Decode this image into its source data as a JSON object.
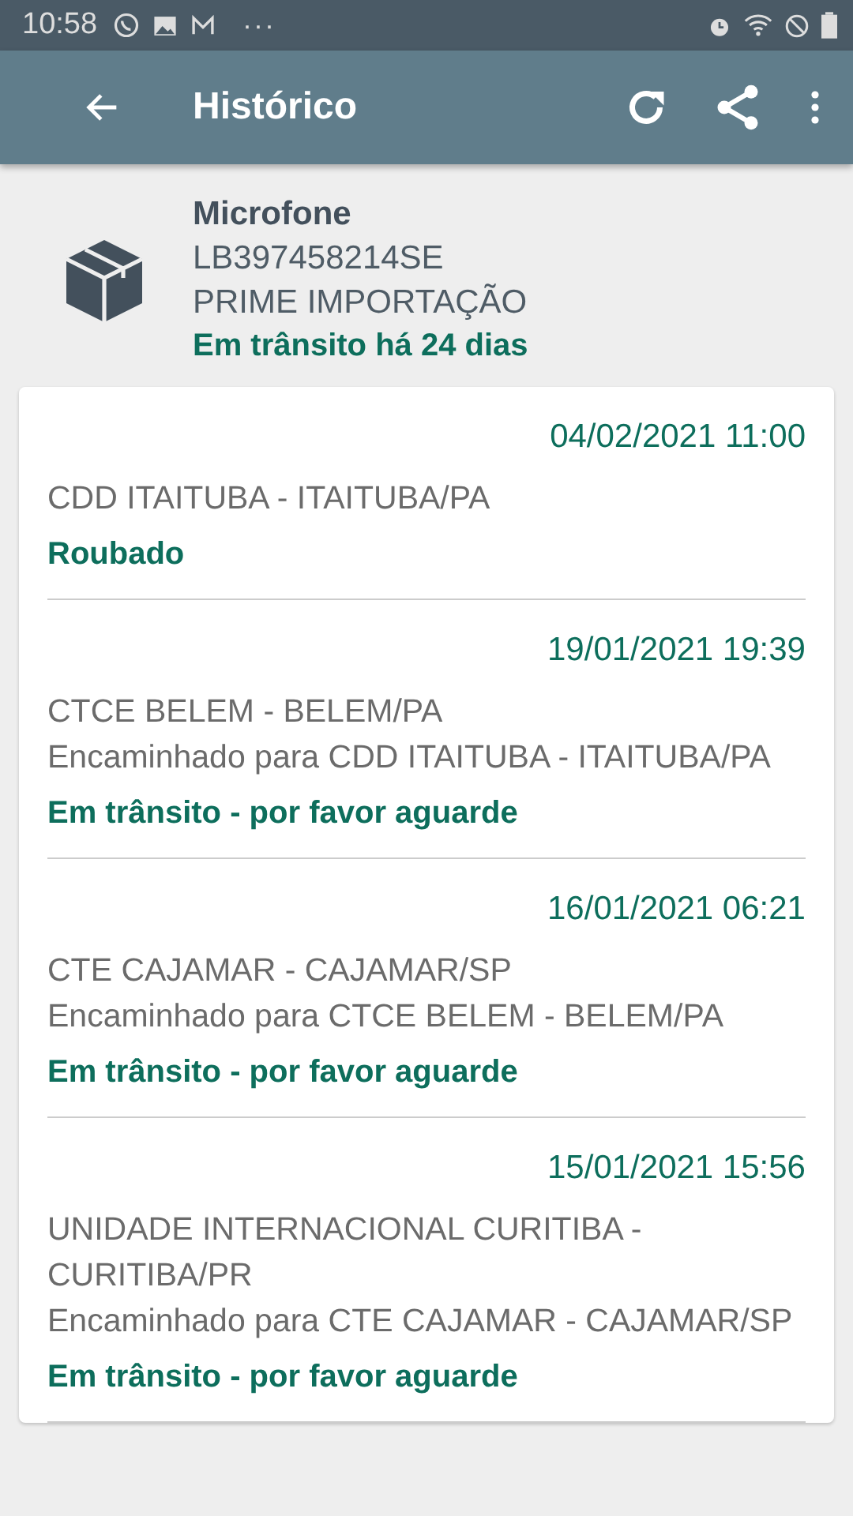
{
  "status_bar": {
    "time": "10:58",
    "more": "···"
  },
  "toolbar": {
    "title": "Histórico"
  },
  "package": {
    "name": "Microfone",
    "code": "LB397458214SE",
    "store": "PRIME IMPORTAÇÃO",
    "status": "Em trânsito há 24 dias"
  },
  "events": [
    {
      "datetime": "04/02/2021 11:00",
      "location": "CDD ITAITUBA - ITAITUBA/PA",
      "status": "Roubado"
    },
    {
      "datetime": "19/01/2021 19:39",
      "location": "CTCE BELEM - BELEM/PA",
      "detail": "Encaminhado para CDD ITAITUBA - ITAITUBA/PA",
      "status": "Em trânsito - por favor aguarde"
    },
    {
      "datetime": "16/01/2021 06:21",
      "location": "CTE CAJAMAR - CAJAMAR/SP",
      "detail": "Encaminhado para CTCE BELEM - BELEM/PA",
      "status": "Em trânsito - por favor aguarde"
    },
    {
      "datetime": "15/01/2021 15:56",
      "location": "UNIDADE INTERNACIONAL CURITIBA - CURITIBA/PR",
      "detail": "Encaminhado para CTE CAJAMAR - CAJAMAR/SP",
      "status": "Em trânsito - por favor aguarde"
    }
  ]
}
